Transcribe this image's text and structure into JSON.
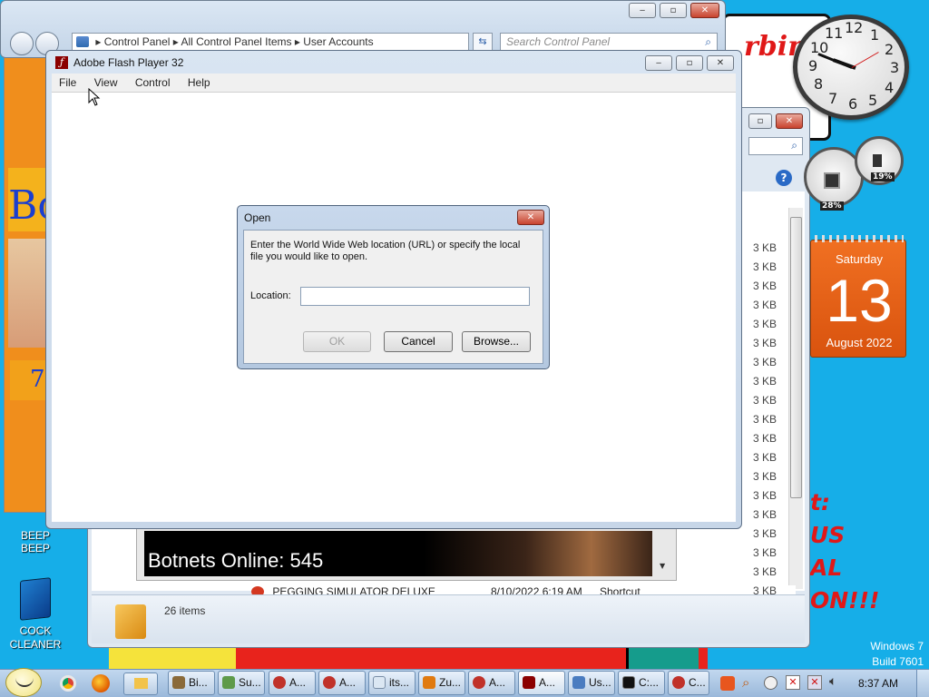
{
  "explorer": {
    "breadcrumb": [
      "Control Panel",
      "All Control Panel Items",
      "User Accounts"
    ],
    "search_placeholder": "Search Control Panel"
  },
  "file_window": {
    "file_sizes": [
      "3 KB",
      "3 KB",
      "3 KB",
      "3 KB",
      "3 KB",
      "3 KB",
      "3 KB",
      "3 KB",
      "3 KB",
      "3 KB",
      "3 KB",
      "3 KB",
      "3 KB",
      "3 KB",
      "3 KB",
      "3 KB",
      "3 KB",
      "3 KB",
      "3 KB",
      "3 KB"
    ],
    "row_name": "PEGGING SIMULATOR DELUXE",
    "row_date": "8/10/2022 6:19 AM",
    "row_type": "Shortcut",
    "row_size": "3 KB",
    "status_count": "26 items"
  },
  "botnet_banner": {
    "text": "Botnets Online: 545"
  },
  "flash": {
    "title": "Adobe Flash Player 32",
    "menu": [
      "File",
      "View",
      "Control",
      "Help"
    ]
  },
  "open_dialog": {
    "title": "Open",
    "instruction": "Enter the World Wide Web location (URL) or specify the local file you would like to open.",
    "location_label": "Location:",
    "location_value": "",
    "ok_label": "OK",
    "cancel_label": "Cancel",
    "browse_label": "Browse..."
  },
  "gadgets": {
    "clock_numbers": [
      "12",
      "1",
      "2",
      "3",
      "4",
      "5",
      "6",
      "7",
      "8",
      "9",
      "10",
      "11"
    ],
    "cpu_percent": "28%",
    "mem_percent": "19%",
    "calendar_day_name": "Saturday",
    "calendar_day": "13",
    "calendar_month_year": "August 2022"
  },
  "desktop": {
    "banner_fragment": "rbin",
    "icons": [
      "BEEP BEEP",
      "COCK CLEANER"
    ],
    "red_text_lines": [
      "t:",
      "US",
      "AL",
      "ON!!!"
    ],
    "left_banner_text": "Bo",
    "left_banner_digit": "7",
    "watermark_os": "Windows 7",
    "watermark_build": "Build 7601"
  },
  "taskbar": {
    "buttons": [
      "Bi...",
      "Su...",
      "A...",
      "A...",
      "its...",
      "Zu...",
      "A...",
      "A...",
      "Us...",
      "C:...",
      "C..."
    ],
    "clock": "8:37 AM"
  },
  "colors": {
    "desktop_blue": "#16aee8",
    "flash_red": "#8b0000",
    "calendar_orange": "#e8611a",
    "dialog_close_red": "#c8432e"
  }
}
